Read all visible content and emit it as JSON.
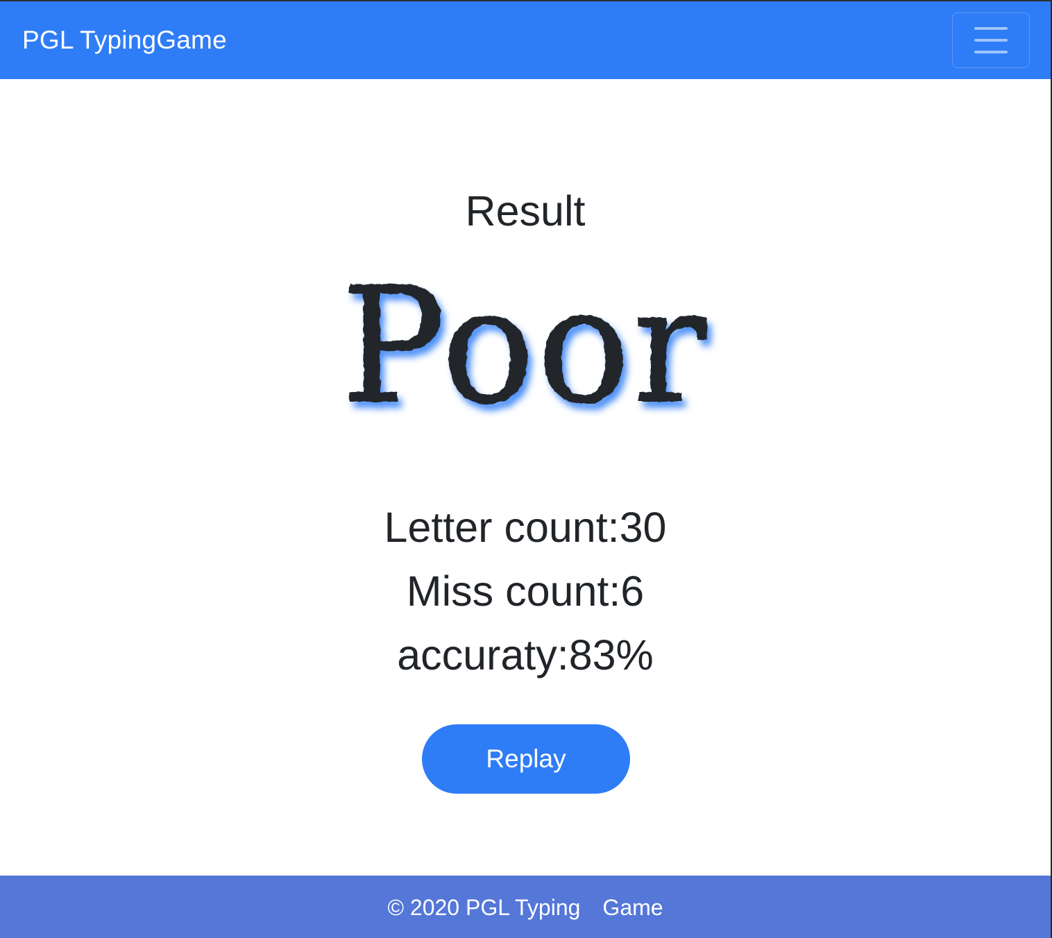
{
  "navbar": {
    "brand": "PGL TypingGame",
    "color": "#2f7df6",
    "menu_icon": "hamburger-menu-icon"
  },
  "main": {
    "heading": "Result",
    "grade": "Poor",
    "grade_shadow_color": "#2f7df6",
    "stats": {
      "letter_count": "Letter count:30",
      "miss_count": "Miss count:6",
      "accuracy": "accuraty:83%"
    },
    "replay_label": "Replay"
  },
  "footer": {
    "copyright": "© 2020 PGL Typing",
    "game": "Game",
    "color": "#5577d8"
  }
}
